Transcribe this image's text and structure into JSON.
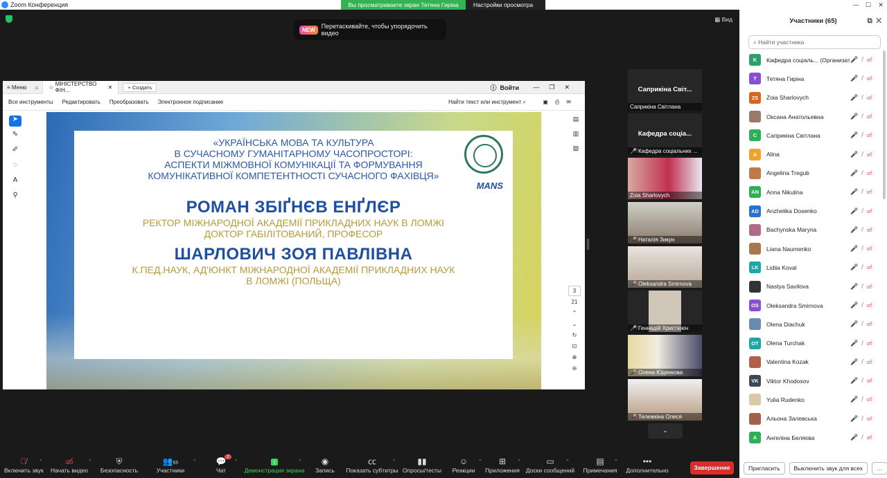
{
  "app": {
    "title": "Zoom Конференция"
  },
  "share_banner": {
    "text": "Вы просматриваете экран Тетяна Гиріна",
    "settings": "Настройки просмотра"
  },
  "window_controls": {
    "minimize": "—",
    "maximize": "☐",
    "close": "✕"
  },
  "stage": {
    "view_label": "Вид",
    "drag_hint": {
      "badge": "NEW",
      "text": "Перетаскивайте, чтобы упорядочить видео"
    }
  },
  "acrobat": {
    "menu": "Меню",
    "tab_title": "МІНІСТЕРСТВО ФІН...",
    "create": "Создать",
    "signin": "Войти",
    "tools": [
      "Все инструменты",
      "Редактировать",
      "Преобразовать",
      "Электронное подписание"
    ],
    "find": "Найти текст или инструмент",
    "page_current": "3",
    "page_total": "21"
  },
  "slide": {
    "conf_lines": [
      "«УКРАЇНСЬКА МОВА ТА КУЛЬТУРА",
      "В СУЧАСНОМУ ГУМАНІТАРНОМУ ЧАСОПРОСТОРІ:",
      "АСПЕКТИ МІЖМОВНОЇ КОМУНІКАЦІЇ ТА ФОРМУВАННЯ",
      "КОМУНІКАТИВНОЇ КОМПЕТЕНТНОСТІ СУЧАСНОГО ФАХІВЦЯ»"
    ],
    "speaker1": "РОМАН ЗБІҐНЄВ ЕНҐЛЄР",
    "speaker1_role": [
      "РЕКТОР МІЖНАРОДНОЇ АКАДЕМІЇ ПРИКЛАДНИХ НАУК В ЛОМЖІ",
      "ДОКТОР ГАБІЛІТОВАНИЙ, ПРОФЕСОР"
    ],
    "speaker2": "ШАРЛОВИЧ ЗОЯ ПАВЛІВНА",
    "speaker2_role": [
      "К.ПЕД.НАУК, АД'ЮНКТ МІЖНАРОДНОЇ АКАДЕМІЇ ПРИКЛАДНИХ НАУК",
      "В ЛОМЖІ (ПОЛЬЩА)"
    ],
    "logo": "MANS"
  },
  "gallery": [
    {
      "big": "Саприкіна Світ...",
      "label": "Саприкіна Світлана"
    },
    {
      "big": "Кафедра соціа...",
      "label": "Кафедра соціальних ..."
    },
    {
      "label": "Zoia Sharlovych"
    },
    {
      "label": "Наталія Зикун"
    },
    {
      "label": "Oleksandra Smirnova"
    },
    {
      "label": "Геннадій Христюкін"
    },
    {
      "label": "Олена Юденкова"
    },
    {
      "label": "Тележкіна Олеся"
    }
  ],
  "participants": {
    "title": "Участники (65)",
    "search_placeholder": "Найти участника",
    "list": [
      {
        "initials": "K",
        "color": "#2f9e6e",
        "name": "Кафедра соціаль... (Организатор, я)"
      },
      {
        "initials": "T",
        "color": "#8a4fd0",
        "name": "Тетяна Гиріна"
      },
      {
        "initials": "ZS",
        "color": "#d7661c",
        "name": "Zoia Sharlovych"
      },
      {
        "initials": "",
        "color": "#9a7a6a",
        "name": "Оксана Анатольевна"
      },
      {
        "initials": "C",
        "color": "#2fae57",
        "name": "Саприкіна Світлана"
      },
      {
        "initials": "A",
        "color": "#f0a22b",
        "name": "Alina"
      },
      {
        "initials": "",
        "color": "#c07a4a",
        "name": "Angelina Tregub"
      },
      {
        "initials": "AN",
        "color": "#2fae57",
        "name": "Anna Nikulina"
      },
      {
        "initials": "AD",
        "color": "#2a6fd1",
        "name": "Anzhelika Dosenko"
      },
      {
        "initials": "",
        "color": "#b06a8a",
        "name": "Bachynska Maryna"
      },
      {
        "initials": "",
        "color": "#a8774e",
        "name": "Liana Naumenko"
      },
      {
        "initials": "LK",
        "color": "#1fa5a5",
        "name": "Lidiia Koval"
      },
      {
        "initials": "",
        "color": "#333333",
        "name": "Nastya Savilova"
      },
      {
        "initials": "OS",
        "color": "#8a4fd0",
        "name": "Oleksandra Smirnova"
      },
      {
        "initials": "",
        "color": "#6a8ab0",
        "name": "Olena Diachuk"
      },
      {
        "initials": "OT",
        "color": "#1fa5a5",
        "name": "Olena Turchak"
      },
      {
        "initials": "",
        "color": "#b0604a",
        "name": "Valentina Kozak"
      },
      {
        "initials": "VK",
        "color": "#3a4a5a",
        "name": "Viktor Khodosov"
      },
      {
        "initials": "",
        "color": "#d9c9a9",
        "name": "Yulia Rudenko"
      },
      {
        "initials": "",
        "color": "#a0604a",
        "name": "Альона Залевська"
      },
      {
        "initials": "A",
        "color": "#2fae57",
        "name": "Ангеліна Беляєва"
      }
    ],
    "invite": "Пригласить",
    "mute_all": "Выключить звук для всех"
  },
  "toolbar": {
    "audio": "Включить звук",
    "video": "Начать видео",
    "security": "Безопасность",
    "participants": "Участники",
    "participants_count": "65",
    "chat": "Чат",
    "chat_badge": "7",
    "share": "Демонстрация экрана",
    "record": "Запись",
    "captions": "Показать субтитры",
    "polls": "Опросы/тесты",
    "reactions": "Реакции",
    "apps": "Приложения",
    "whiteboards": "Доски сообщений",
    "notes": "Примечания",
    "more": "Дополнительно",
    "end": "Завершение"
  }
}
